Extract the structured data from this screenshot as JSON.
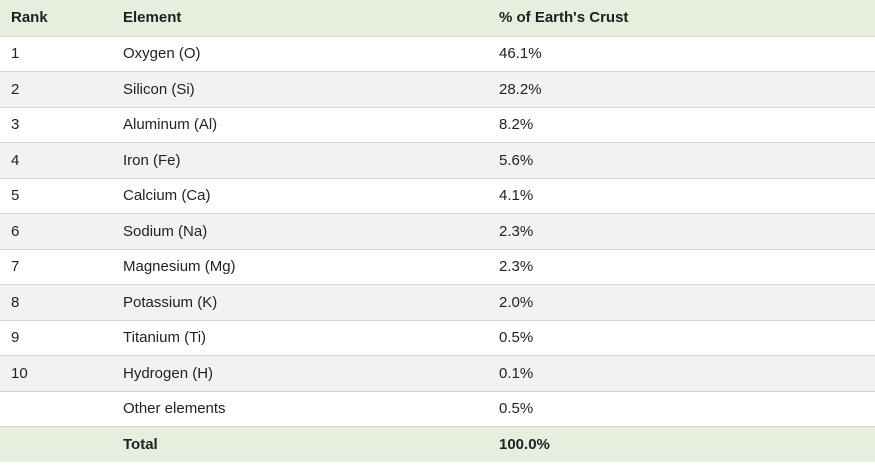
{
  "table": {
    "headers": [
      "Rank",
      "Element",
      "% of Earth's Crust"
    ],
    "rows": [
      [
        "1",
        "Oxygen (O)",
        "46.1%"
      ],
      [
        "2",
        "Silicon (Si)",
        "28.2%"
      ],
      [
        "3",
        "Aluminum (Al)",
        "8.2%"
      ],
      [
        "4",
        "Iron (Fe)",
        "5.6%"
      ],
      [
        "5",
        "Calcium (Ca)",
        "4.1%"
      ],
      [
        "6",
        "Sodium (Na)",
        "2.3%"
      ],
      [
        "7",
        "Magnesium (Mg)",
        "2.3%"
      ],
      [
        "8",
        "Potassium (K)",
        "2.0%"
      ],
      [
        "9",
        "Titanium (Ti)",
        "0.5%"
      ],
      [
        "10",
        "Hydrogen (H)",
        "0.1%"
      ],
      [
        "",
        "Other elements",
        "0.5%"
      ]
    ],
    "total": [
      "",
      "Total",
      "100.0%"
    ]
  },
  "colors": {
    "header_bg": "#e6eedd",
    "alt_row_bg": "#f2f2f2",
    "border": "#d4d4d4"
  }
}
